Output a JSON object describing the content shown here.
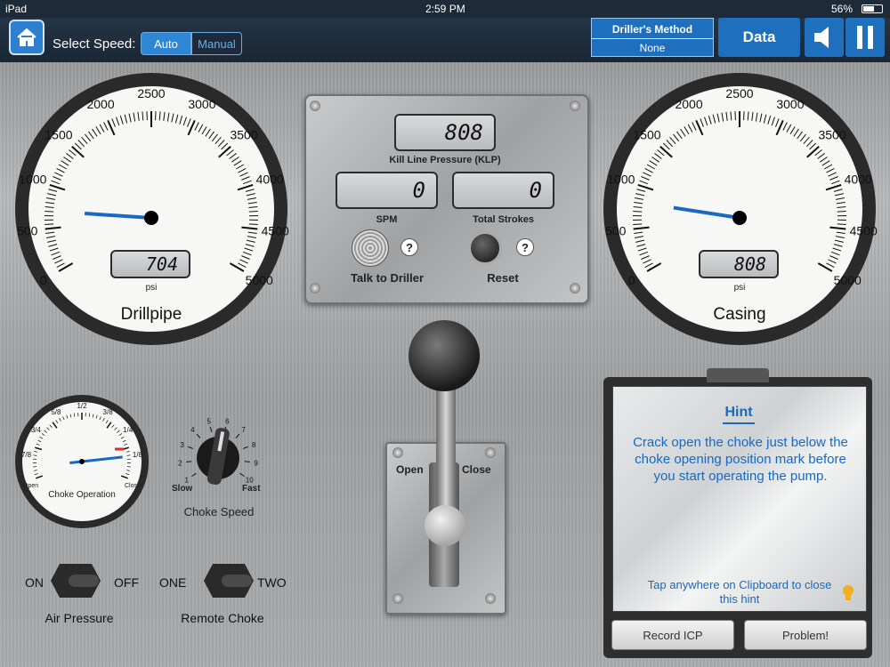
{
  "status_bar": {
    "device": "iPad",
    "time": "2:59 PM",
    "battery": "56%"
  },
  "top_bar": {
    "speed_label": "Select Speed:",
    "speed_options": [
      "Auto",
      "Manual"
    ],
    "selected_speed": "Auto",
    "method_title": "Driller's Method",
    "method_value": "None",
    "data_label": "Data",
    "icons": {
      "home": "home-icon",
      "sound": "speaker-icon",
      "pause": "pause-icon"
    }
  },
  "drillpipe_gauge": {
    "title": "Drillpipe",
    "unit": "psi",
    "reading": "704",
    "value": 704,
    "max": 5000,
    "ticks": [
      "0",
      "500",
      "1000",
      "1500",
      "2000",
      "2500",
      "3000",
      "3500",
      "4000",
      "4500",
      "5000"
    ]
  },
  "casing_gauge": {
    "title": "Casing",
    "unit": "psi",
    "reading": "808",
    "value": 808,
    "max": 5000,
    "ticks": [
      "0",
      "500",
      "1000",
      "1500",
      "2000",
      "2500",
      "3000",
      "3500",
      "4000",
      "4500",
      "5000"
    ]
  },
  "control_panel": {
    "klp_value": "808",
    "klp_label": "Kill Line Pressure (KLP)",
    "spm_value": "0",
    "spm_label": "SPM",
    "strokes_value": "0",
    "strokes_label": "Total Strokes",
    "talk_label": "Talk to Driller",
    "reset_label": "Reset",
    "help_symbol": "?"
  },
  "choke_gauge": {
    "title": "Choke Operation",
    "ticks": [
      "7/8",
      "3/4",
      "5/8",
      "1/2",
      "3/8",
      "1/4",
      "1/8"
    ],
    "open_label": "Open",
    "close_label": "Close",
    "position_fraction": 0.12
  },
  "choke_speed": {
    "title": "Choke Speed",
    "ticks": [
      "1",
      "2",
      "3",
      "4",
      "5",
      "6",
      "7",
      "8",
      "9",
      "10"
    ],
    "slow_label": "Slow",
    "fast_label": "Fast"
  },
  "lever": {
    "open_label": "Open",
    "close_label": "Close"
  },
  "switches": {
    "air": {
      "title": "Air Pressure",
      "left": "ON",
      "right": "OFF"
    },
    "remote": {
      "title": "Remote Choke",
      "left": "ONE",
      "right": "TWO"
    }
  },
  "clipboard": {
    "title": "Hint",
    "message": "Crack open the choke just below the choke opening position mark before you start operating the pump.",
    "footer": "Tap anywhere on Clipboard to close this hint",
    "record_label": "Record ICP",
    "problem_label": "Problem!"
  }
}
